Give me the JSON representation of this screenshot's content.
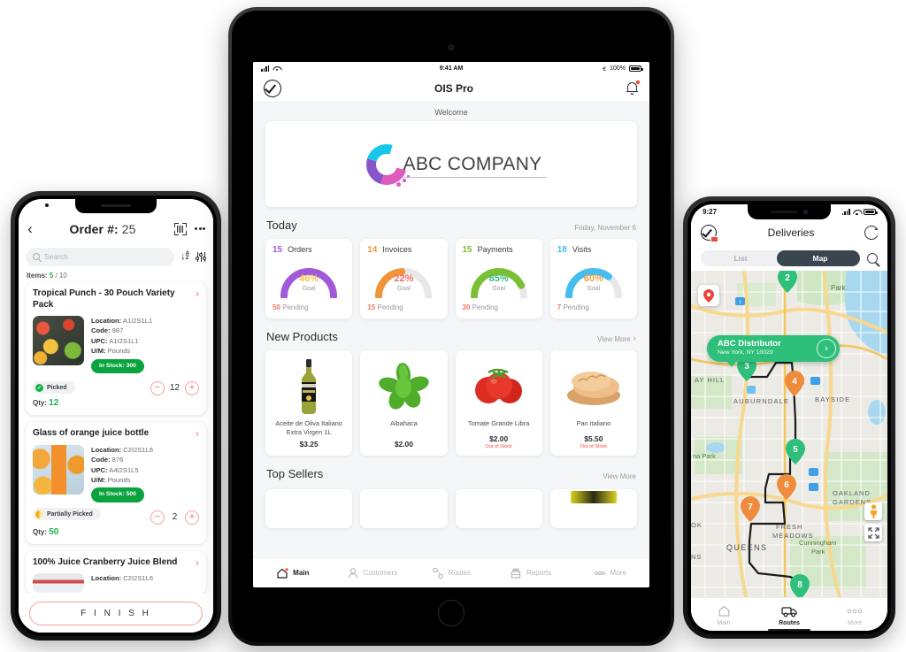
{
  "phone_left": {
    "header": {
      "back_icon": "chevron-left-icon",
      "title_label": "Order #:",
      "order_number": "25",
      "scan_icon": "barcode-scan-icon",
      "more_icon": "more-dots-icon"
    },
    "search": {
      "placeholder": "Search",
      "sort_icon": "sort-az-icon",
      "filter_icon": "filter-sliders-icon"
    },
    "items_counter": {
      "label": "Items:",
      "picked": "5",
      "total": "/ 10"
    },
    "products": [
      {
        "name": "Tropical Punch - 30 Pouch Variety Pack",
        "location_label": "Location:",
        "location": "A1I2S1L1",
        "code_label": "Code:",
        "code": "987",
        "upc_label": "UPC:",
        "upc": "A1I2S1L1",
        "um_label": "U/M:",
        "um": "Pounds",
        "stock": "In Stock: 300",
        "status": "Picked",
        "status_icon": "check-circle-icon",
        "qty_label": "Qty:",
        "qty": "12",
        "stepper_value": "12"
      },
      {
        "name": "Glass of orange juice bottle",
        "location_label": "Location:",
        "location": "C2I2S1L6",
        "code_label": "Code:",
        "code": "876",
        "upc_label": "UPC:",
        "upc": "A4I2S1L5",
        "um_label": "U/M:",
        "um": "Pounds",
        "stock": "In Stock: 500",
        "status": "Partially Picked",
        "status_icon": "half-circle-icon",
        "qty_label": "Qty:",
        "qty": "50",
        "stepper_value": "2"
      },
      {
        "name": "100% Juice Cranberry Juice Blend",
        "location_label": "Location:",
        "location": "C2I2S1L6",
        "code_label": "",
        "code": "",
        "upc_label": "",
        "upc": "",
        "um_label": "",
        "um": "",
        "stock": "",
        "status": "",
        "status_icon": "",
        "qty_label": "",
        "qty": "",
        "stepper_value": ""
      }
    ],
    "finish_button": "F I N I S H"
  },
  "tablet": {
    "status_bar": {
      "time": "9:41 AM",
      "battery": "100%",
      "signal_icon": "cellular-bars-icon",
      "wifi_icon": "wifi-icon",
      "bluetooth_icon": "bluetooth-icon",
      "battery_icon": "battery-full-icon"
    },
    "nav": {
      "logo_icon": "check-oval-logo-icon",
      "title": "OIS Pro",
      "bell_icon": "bell-notification-icon"
    },
    "welcome_label": "Welcome",
    "company_logo": {
      "text": "ABC COMPANY",
      "swoosh_icon": "gradient-swoosh-icon"
    },
    "today": {
      "heading": "Today",
      "date": "Friday, November 6",
      "cards": [
        {
          "count": "15",
          "label": "Orders",
          "percent": "46%",
          "goal_label": "Goal",
          "pending_count": "50",
          "pending_label": "Pending",
          "arc_color": "#a259d9",
          "pct_color": "#f5c243"
        },
        {
          "count": "14",
          "label": "Invoices",
          "percent": "22%",
          "goal_label": "Goal",
          "pending_count": "15",
          "pending_label": "Pending",
          "arc_color": "#f0943c",
          "pct_color": "#f26b63"
        },
        {
          "count": "15",
          "label": "Payments",
          "percent": "85%",
          "goal_label": "Goal",
          "pending_count": "30",
          "pending_label": "Pending",
          "arc_color": "#79c034",
          "pct_color": "#38b97a"
        },
        {
          "count": "18",
          "label": "Visits",
          "percent": "60%",
          "goal_label": "Goal",
          "pending_count": "7",
          "pending_label": "Pending",
          "arc_color": "#45bdf0",
          "pct_color": "#f4a03c"
        }
      ]
    },
    "new_products": {
      "heading": "New Products",
      "view_more": "View More",
      "items": [
        {
          "name": "Aceite de Oliva Italiano Extra Virgen 1L",
          "price": "$3.25",
          "stock_note": "",
          "image": "olive-oil-bottle-image"
        },
        {
          "name": "Albahaca",
          "price": "$2.00",
          "stock_note": "",
          "image": "basil-leaves-image"
        },
        {
          "name": "Tomate Grande Libra",
          "price": "$2.00",
          "stock_note": "Out of Stock",
          "image": "tomatoes-image"
        },
        {
          "name": "Pan italiano",
          "price": "$5.50",
          "stock_note": "Out of Stock",
          "image": "bread-loaf-image"
        }
      ]
    },
    "top_sellers": {
      "heading": "Top Sellers",
      "view_more": "View More"
    },
    "tabbar": [
      {
        "label": "Main",
        "icon": "home-icon",
        "active": true
      },
      {
        "label": "Customers",
        "icon": "user-icon",
        "active": false
      },
      {
        "label": "Routes",
        "icon": "route-icon",
        "active": false
      },
      {
        "label": "Reports",
        "icon": "reports-icon",
        "active": false
      },
      {
        "label": "More",
        "icon": "more-dots-icon",
        "active": false
      }
    ]
  },
  "phone_right": {
    "status_bar": {
      "time": "9:27",
      "signal_icon": "cellular-bars-icon",
      "wifi_icon": "wifi-icon",
      "battery_icon": "battery-full-icon"
    },
    "header": {
      "logo_icon": "check-oval-logo-icon",
      "title": "Deliveries",
      "refresh_icon": "refresh-icon"
    },
    "segmented": {
      "options": [
        "List",
        "Map"
      ],
      "selected": "Map",
      "search_icon": "search-icon"
    },
    "map": {
      "callout": {
        "title": "ABC Distributor",
        "subtitle": "New York, NY 10029",
        "go_icon": "chevron-right-icon"
      },
      "pin_box_icon": "map-pin-icon",
      "street_view_icon": "pegman-icon",
      "expand_icon": "expand-arrows-icon",
      "markers": [
        {
          "number": "2",
          "color": "#2ec07a"
        },
        {
          "number": "3",
          "color": "#2ec07a"
        },
        {
          "number": "4",
          "color": "#ef8b3c"
        },
        {
          "number": "5",
          "color": "#2ec07a"
        },
        {
          "number": "6",
          "color": "#ef8b3c"
        },
        {
          "number": "7",
          "color": "#ef8b3c"
        },
        {
          "number": "8",
          "color": "#2ec07a"
        }
      ],
      "labels": [
        "Park",
        "AY HILL",
        "AUBURNDALE",
        "BAYSIDE",
        "na Park",
        "OAKLAND GARDENS",
        "FRESH MEADOWS",
        "QUEENS",
        "Cunningham Park",
        "OK",
        "NS"
      ]
    },
    "tabbar": [
      {
        "label": "Main",
        "icon": "home-icon",
        "active": false
      },
      {
        "label": "Routes",
        "icon": "truck-icon",
        "active": true
      },
      {
        "label": "More",
        "icon": "more-dots-icon",
        "active": false
      }
    ]
  }
}
